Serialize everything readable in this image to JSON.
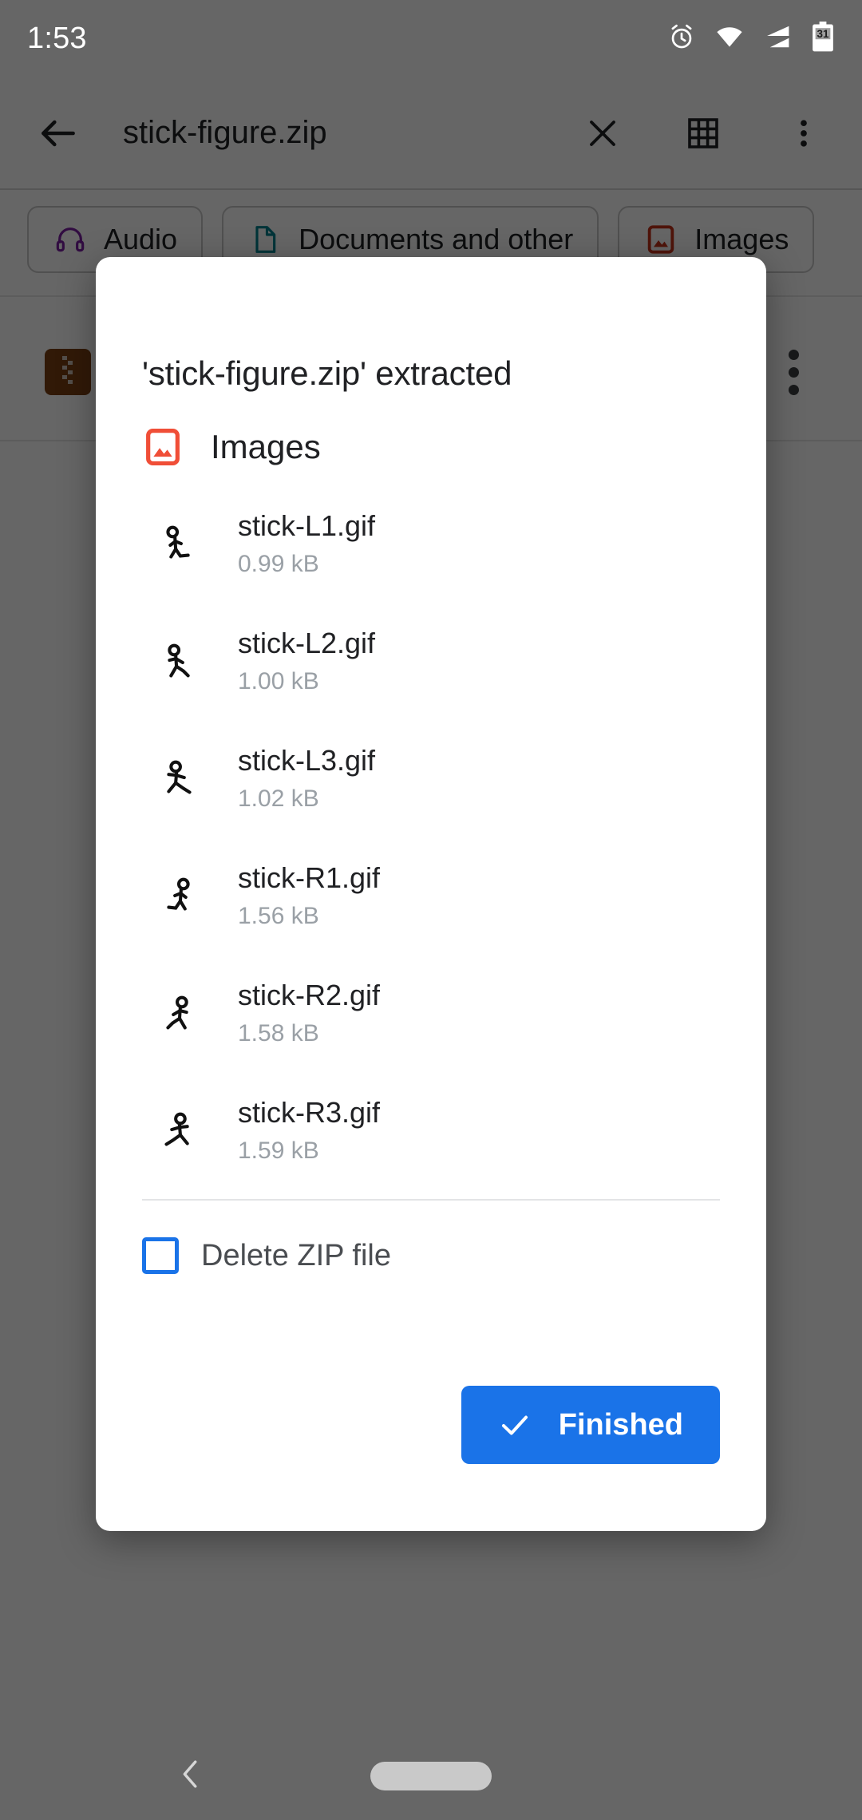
{
  "status_bar": {
    "time": "1:53",
    "icons": [
      "alarm-icon",
      "wifi-icon",
      "signal-icon",
      "battery-icon"
    ],
    "battery_badge": "31"
  },
  "toolbar": {
    "back_label": "Back",
    "title": "stick-figure.zip",
    "close_label": "Close",
    "grid_label": "Grid view",
    "overflow_label": "More options"
  },
  "chips": [
    {
      "label": "Audio",
      "icon": "headphones-icon",
      "color": "#7B1FA2"
    },
    {
      "label": "Documents and other",
      "icon": "document-icon",
      "color": "#00838F"
    },
    {
      "label": "Images",
      "icon": "image-icon",
      "color": "#C5321B"
    }
  ],
  "background_row": {
    "icon": "zip-file-icon",
    "icon_color": "#7B3F13",
    "overflow_label": "More options"
  },
  "dialog": {
    "title": "'stick-figure.zip' extracted",
    "section": {
      "label": "Images",
      "icon": "image-icon",
      "color": "#F04E37"
    },
    "files": [
      {
        "name": "stick-L1.gif",
        "size": "0.99 kB",
        "thumb": "stick-figure-thumbnail"
      },
      {
        "name": "stick-L2.gif",
        "size": "1.00 kB",
        "thumb": "stick-figure-thumbnail"
      },
      {
        "name": "stick-L3.gif",
        "size": "1.02 kB",
        "thumb": "stick-figure-thumbnail"
      },
      {
        "name": "stick-R1.gif",
        "size": "1.56 kB",
        "thumb": "stick-figure-thumbnail"
      },
      {
        "name": "stick-R2.gif",
        "size": "1.58 kB",
        "thumb": "stick-figure-thumbnail"
      },
      {
        "name": "stick-R3.gif",
        "size": "1.59 kB",
        "thumb": "stick-figure-thumbnail"
      }
    ],
    "checkbox": {
      "label": "Delete ZIP file",
      "checked": false,
      "accent": "#1a73e8"
    },
    "primary_button": {
      "label": "Finished",
      "icon": "check-icon",
      "color": "#1a73e8"
    }
  },
  "nav_bar": {
    "back_label": "Back",
    "home_label": "Home"
  }
}
